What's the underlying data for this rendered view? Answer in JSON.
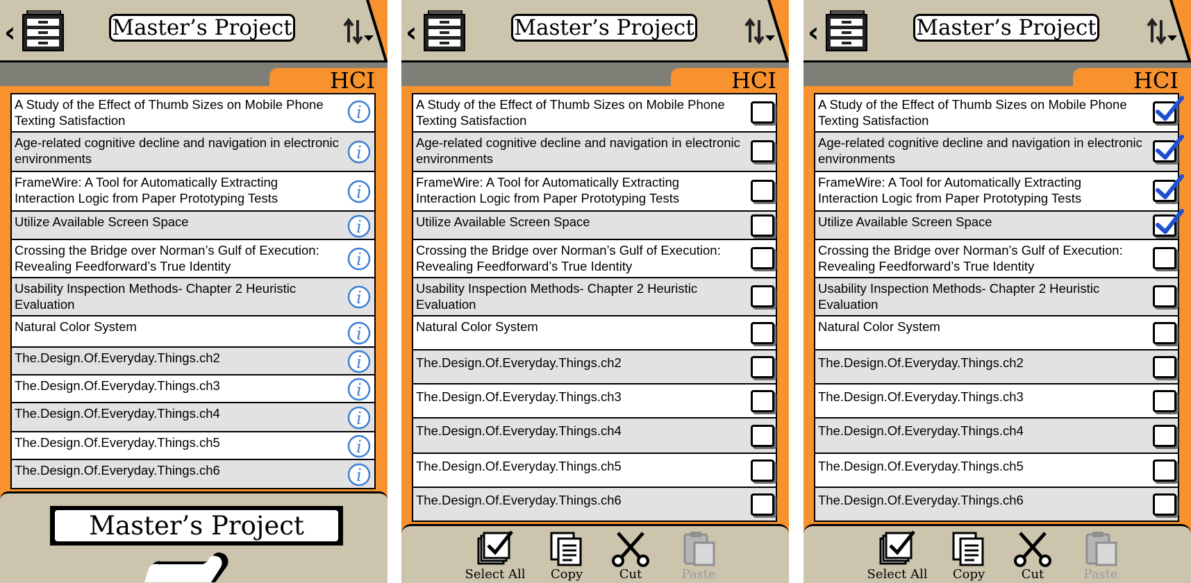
{
  "colors": {
    "header_bg": "#ccc4ad",
    "accent_orange": "#f7922f",
    "tab_bar_gray": "#7f7f78",
    "info_blue": "#3b7fd4",
    "check_blue": "#1f4fd1",
    "disabled_gray": "#9a9a9a"
  },
  "header": {
    "title": "Master’s Project",
    "back_icon": "chevron-left-icon",
    "folder_icon": "file-cabinet-icon",
    "sort_icon": "sort-arrows-icon"
  },
  "tab": {
    "label": "HCI"
  },
  "documents": [
    {
      "title": "A Study of the Effect of Thumb Sizes on Mobile Phone Texting Satisfaction"
    },
    {
      "title": "Age-related cognitive decline and navigation in electronic environments"
    },
    {
      "title": "FrameWire: A Tool for Automatically Extracting Interaction Logic from Paper Prototyping Tests"
    },
    {
      "title": "Utilize Available Screen Space"
    },
    {
      "title": "Crossing the Bridge over Norman’s Gulf of Execution: Revealing Feedforward’s True Identity"
    },
    {
      "title": "Usability Inspection Methods- Chapter 2 Heuristic Evaluation"
    },
    {
      "title": "Natural Color System"
    },
    {
      "title": "The.Design.Of.Everyday.Things.ch2"
    },
    {
      "title": "The.Design.Of.Everyday.Things.ch3"
    },
    {
      "title": "The.Design.Of.Everyday.Things.ch4"
    },
    {
      "title": "The.Design.Of.Everyday.Things.ch5"
    },
    {
      "title": "The.Design.Of.Everyday.Things.ch6"
    }
  ],
  "panels": [
    {
      "mode": "info"
    },
    {
      "mode": "select",
      "checked": [
        false,
        false,
        false,
        false,
        false,
        false,
        false,
        false,
        false,
        false,
        false,
        false
      ]
    },
    {
      "mode": "select",
      "checked": [
        true,
        true,
        true,
        true,
        false,
        false,
        false,
        false,
        false,
        false,
        false,
        false
      ]
    }
  ],
  "bottom_drawer": {
    "title": "Master’s Project",
    "handle_icon": "drawer-handle-icon"
  },
  "toolbar": {
    "select_all": {
      "label": "Select All",
      "icon": "select-all-icon"
    },
    "copy": {
      "label": "Copy",
      "icon": "copy-icon"
    },
    "cut": {
      "label": "Cut",
      "icon": "scissors-icon"
    },
    "paste": {
      "label": "Paste",
      "icon": "paste-icon",
      "enabled": false
    }
  }
}
